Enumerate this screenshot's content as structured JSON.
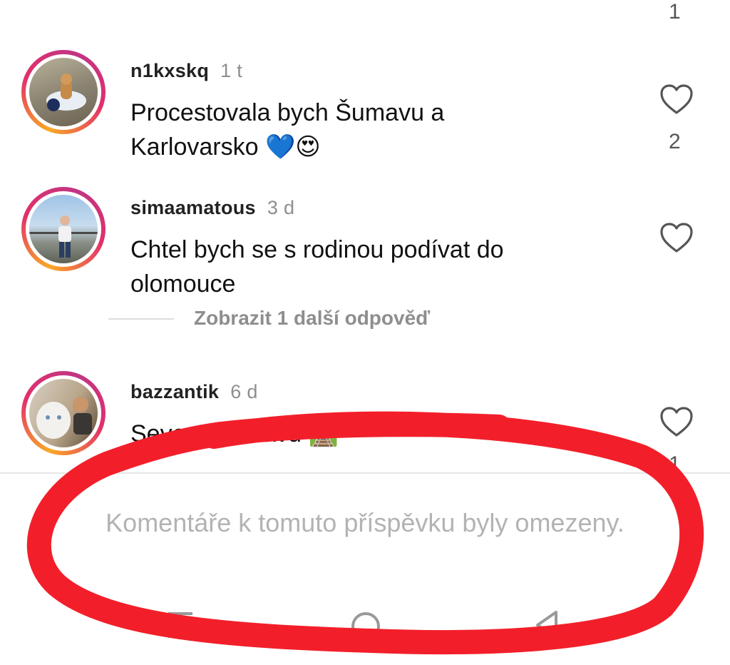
{
  "top": {
    "like_count": "1"
  },
  "comments": [
    {
      "username": "n1kxskq",
      "time": "1 t",
      "text_line1": "Procestovala bych Šumavu a",
      "text_line2": "Karlovarsko",
      "emojis": "💙😍",
      "like_count": "2"
    },
    {
      "username": "simaamatous",
      "time": "3 d",
      "text_line1": "Chtel bych se s rodinou podívat do",
      "text_line2": "olomouce",
      "like_count": ""
    },
    {
      "username": "bazzantik",
      "time": "6 d",
      "text_line1": "Severní Moravu",
      "emojis": "🛤️",
      "like_count": "1"
    }
  ],
  "replies_link": "Zobrazit 1 další odpověď",
  "restricted_notice": "Komentáře k tomuto příspěvku byly omezeny.",
  "colors": {
    "annotation": "#f21f2a",
    "muted": "#8e8e8e"
  }
}
